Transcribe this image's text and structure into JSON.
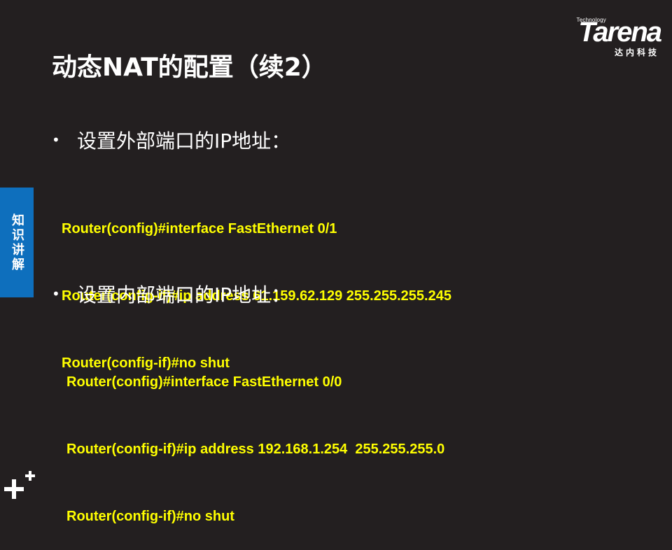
{
  "logo": {
    "tech_text": "Technology",
    "word": "Tarena",
    "cn": "达内科技"
  },
  "slide": {
    "title": "动态NAT的配置（续2）"
  },
  "side_tab": {
    "label": "知识讲解"
  },
  "sections": [
    {
      "bullet_symbol": "•",
      "heading": "设置外部端口的IP地址：",
      "code": [
        "Router(config)#interface FastEthernet 0/1",
        "Router(config-if)#ip address 61.159.62.129 255.255.255.245",
        "Router(config-if)#no shut"
      ]
    },
    {
      "bullet_symbol": "•",
      "heading": "设置内部端口的IP地址：",
      "code": [
        "Router(config)#interface FastEthernet 0/0",
        "Router(config-if)#ip address 192.168.1.254  255.255.255.0",
        "Router(config-if)#no shut"
      ]
    }
  ],
  "colors": {
    "background": "#231f20",
    "code_text": "#ffff00",
    "side_tab": "#0e6fbd",
    "text": "#ffffff"
  },
  "icons": {
    "corner": "plus-plus-icon"
  }
}
